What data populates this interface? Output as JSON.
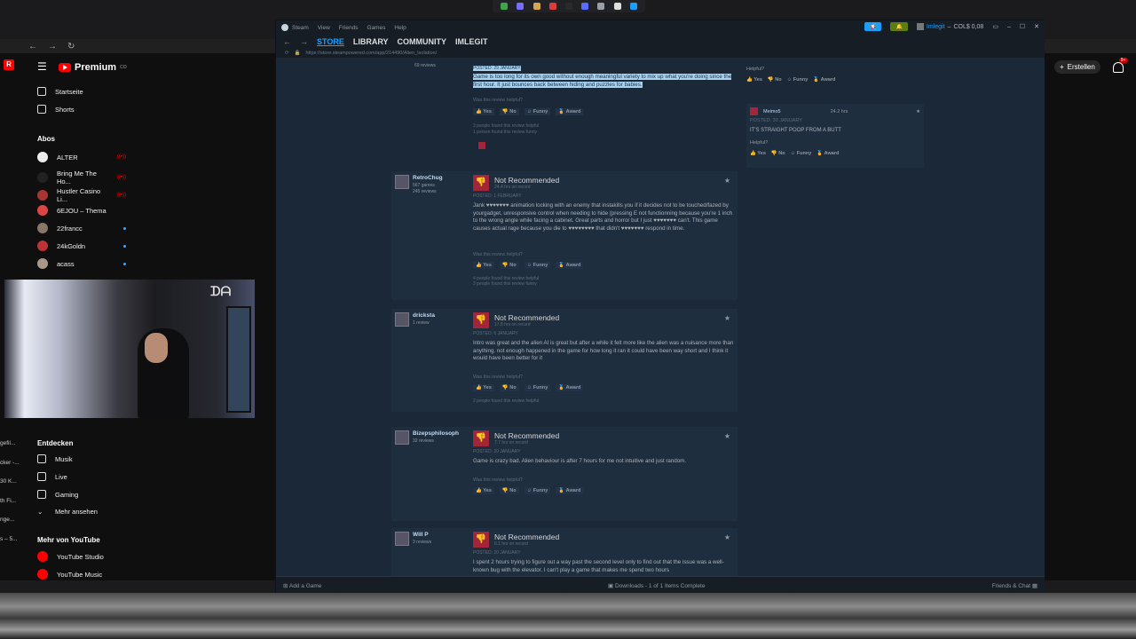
{
  "taskbar": {
    "icons": [
      "#3ea64a",
      "#7b6cff",
      "#d8a64e",
      "#e03b3b",
      "#2a2a2a",
      "#5a6cff",
      "#9aa0a6",
      "#e0e0e0",
      "#1a9fff"
    ]
  },
  "youtube": {
    "brand": "Premium",
    "brand_sup": "CO",
    "nav": [
      "Startseite",
      "Shorts"
    ],
    "subs_heading": "Abos",
    "subs": [
      {
        "name": "ALTER",
        "color": "#eee",
        "badge": "live"
      },
      {
        "name": "Bring Me The Ho...",
        "color": "#222",
        "badge": "live"
      },
      {
        "name": "Hustler Casino Li...",
        "color": "#a33",
        "badge": "live"
      },
      {
        "name": "6EJOU – Thema",
        "color": "#d44",
        "badge": ""
      },
      {
        "name": "22francc",
        "color": "#876",
        "badge": "dot"
      },
      {
        "name": "24kGoldn",
        "color": "#b33",
        "badge": "dot"
      },
      {
        "name": "acass",
        "color": "#a98",
        "badge": "dot"
      }
    ],
    "explore_heading": "Entdecken",
    "explore": [
      "Musik",
      "Live",
      "Gaming",
      "Mehr ansehen"
    ],
    "more_heading": "Mehr von YouTube",
    "more": [
      "YouTube Studio",
      "YouTube Music"
    ],
    "left_trunc": [
      "gefil...",
      "cker -...",
      "30 K...",
      "th Fi...",
      "nge...",
      "s – 5..."
    ],
    "create": "Erstellen",
    "bell_count": "9+"
  },
  "steam": {
    "menu": [
      "Steam",
      "View",
      "Friends",
      "Games",
      "Help"
    ],
    "user": "Imlegit",
    "wallet": "COL$ 0,08",
    "tabs": {
      "store": "STORE",
      "library": "LIBRARY",
      "community": "COMMUNITY",
      "user": "IMLEGIT"
    },
    "url": "https://store.steampowered.com/app/214490/Alien_Isolation/",
    "footer": {
      "add_game": "Add a Game",
      "downloads": "Downloads - 1 of 1 Items Complete",
      "friends": "Friends & Chat"
    },
    "top_review": {
      "reviews_count": "69 reviews",
      "posted": "POSTED: 29 JANUARY",
      "text": "Game is too long for its own good without enough meaningful variety to mix up what you're doing since the first hour. It just bounces back between hiding and puzzles for babies.",
      "found": [
        "3 people found this review helpful",
        "1 person found this review funny"
      ]
    },
    "labels": {
      "not_recommended": "Not Recommended",
      "helpful": "Was this review helpful?",
      "yes": "Yes",
      "no": "No",
      "funny": "Funny",
      "award": "Award"
    },
    "reviews": [
      {
        "name": "RetroChug",
        "meta": [
          "567 games",
          "245 reviews"
        ],
        "hrs": "24.4 hrs on record",
        "posted": "POSTED: 1 FEBRUARY",
        "text": "Jank ♥♥♥♥♥♥♥ animation locking with an enemy that instakills you if it decides not to be touched/fazed by yourgadget, unresponsive control when needing to hide (pressing E not functionning because you're 1 inch to the wrong angle while facing a cabinet. Great parts and horror but I just ♥♥♥♥♥♥♥ can't. This game causes actual rage because you die to ♥♥♥♥♥♥♥♥ that didn't ♥♥♥♥♥♥♥ respond in time.",
        "found": [
          "4 people found this review helpful",
          "3 people found this review funny"
        ]
      },
      {
        "name": "dricksta",
        "meta": [
          "1 review"
        ],
        "hrs": "17.8 hrs on record",
        "posted": "POSTED: 6 JANUARY",
        "text": "Intro was great and the alien AI is great but after a while it felt more like the alien was a nuisance more than anything. not enough happened in the game for how long it ran it could have been way short and I think it would have been better for it",
        "found": [
          "2 people found this review helpful"
        ]
      },
      {
        "name": "Bizepsphilosoph",
        "meta": [
          "32 reviews"
        ],
        "hrs": "7.7 hrs on record",
        "posted": "POSTED: 20 JANUARY",
        "text": "Game is crazy bad. Alien behaviour is after 7 hours for me not intuitive and just random.",
        "found": []
      },
      {
        "name": "Will P",
        "meta": [
          "3 reviews"
        ],
        "hrs": "6.1 hrs on record",
        "posted": "POSTED: 20 JANUARY",
        "text": "I spent 2 hours trying to figure out a way past the second level only to find out that the issue was a well-known bug with the elevator. I can't play a game that makes me spend two hours",
        "found": []
      }
    ],
    "side": {
      "helpful1": "Helpful?",
      "user": "Meimo5",
      "hrs": "24.2 hrs",
      "posted": "POSTED: 30 JANUARY",
      "text": "IT'S STRAIGHT POOP FROM A BUTT",
      "helpful2": "Helpful?"
    }
  }
}
